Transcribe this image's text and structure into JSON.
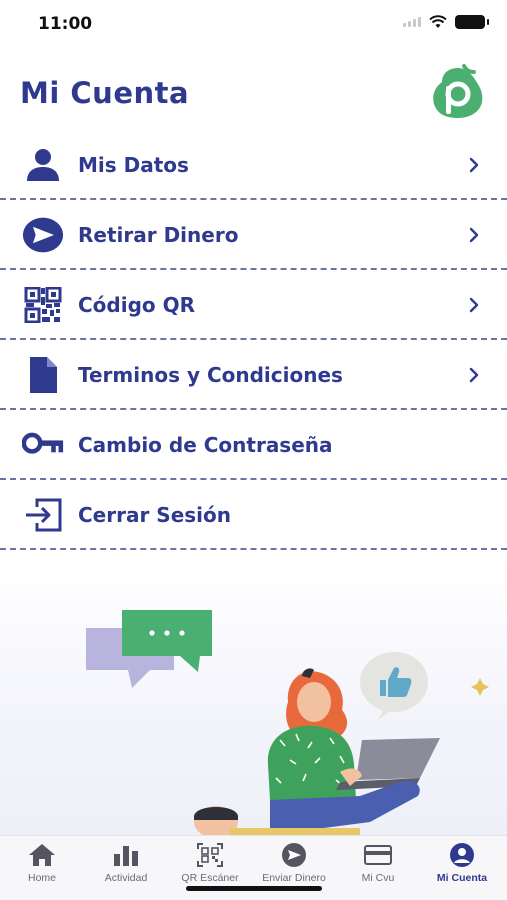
{
  "status_bar": {
    "time": "11:00"
  },
  "header": {
    "title": "Mi Cuenta"
  },
  "menu": [
    {
      "label": "Mis Datos",
      "icon": "user-icon",
      "has_chevron": true
    },
    {
      "label": "Retirar Dinero",
      "icon": "send-icon",
      "has_chevron": true
    },
    {
      "label": "Código QR",
      "icon": "qr-code-icon",
      "has_chevron": true
    },
    {
      "label": "Terminos y Condiciones",
      "icon": "document-icon",
      "has_chevron": true
    },
    {
      "label": "Cambio de Contraseña",
      "icon": "key-icon",
      "has_chevron": false
    },
    {
      "label": "Cerrar Sesión",
      "icon": "logout-icon",
      "has_chevron": false
    }
  ],
  "bottom_nav": [
    {
      "label": "Home",
      "icon": "home-icon"
    },
    {
      "label": "Actividad",
      "icon": "bar-chart-icon"
    },
    {
      "label": "QR Escáner",
      "icon": "qr-scanner-icon"
    },
    {
      "label": "Enviar Dinero",
      "icon": "send-icon"
    },
    {
      "label": "Mi Cvu",
      "icon": "card-icon"
    },
    {
      "label": "Mi Cuenta",
      "icon": "account-icon",
      "active": true
    }
  ],
  "colors": {
    "primary": "#2f3a8f",
    "brand_green": "#4caf72",
    "divider": "#6b74a6",
    "nav_inactive": "#6a6a78"
  }
}
